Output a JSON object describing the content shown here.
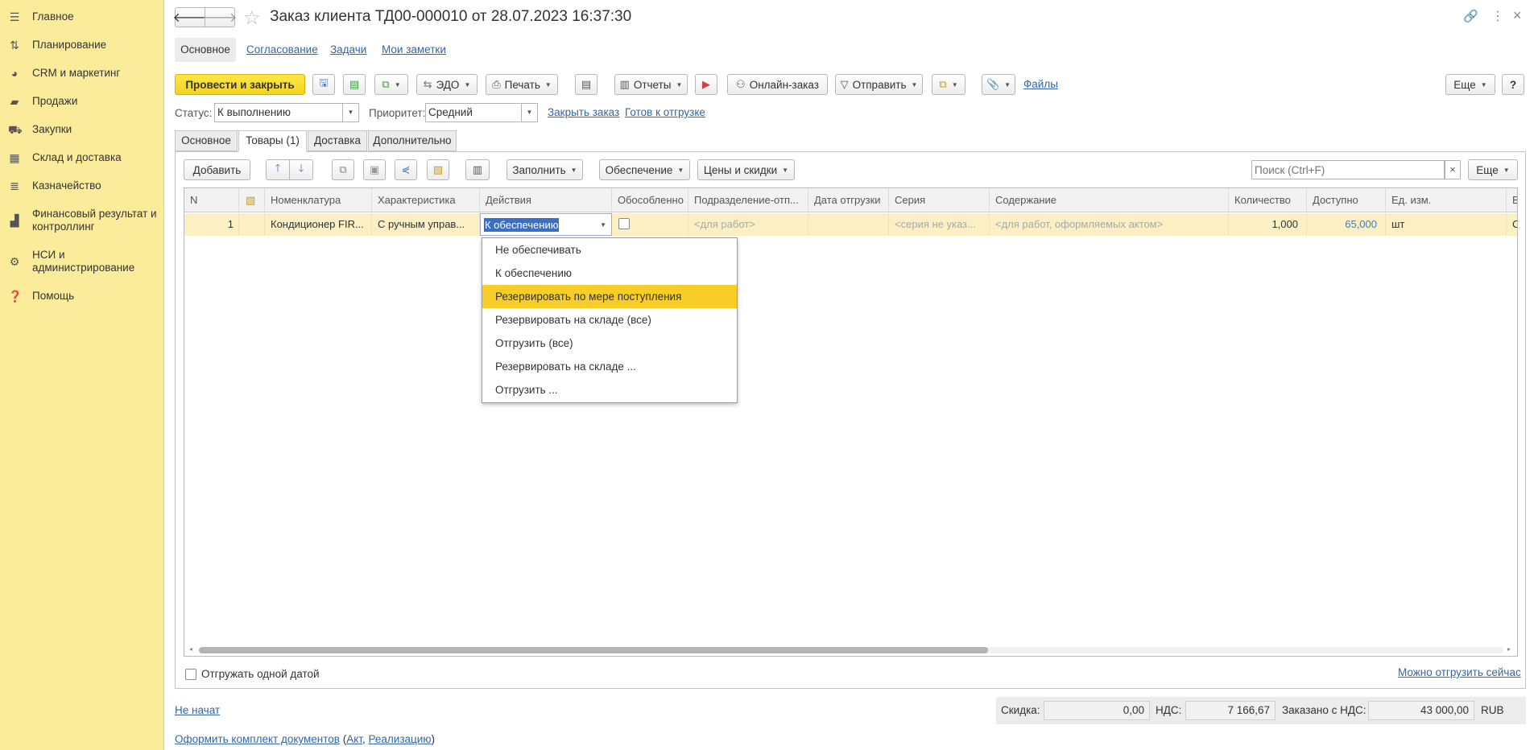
{
  "sidebar": {
    "items": [
      {
        "label": "Главное",
        "icon": "menu-icon"
      },
      {
        "label": "Планирование",
        "icon": "planning-icon"
      },
      {
        "label": "CRM и маркетинг",
        "icon": "pie-chart-icon"
      },
      {
        "label": "Продажи",
        "icon": "bag-icon"
      },
      {
        "label": "Закупки",
        "icon": "cart-icon"
      },
      {
        "label": "Склад и доставка",
        "icon": "grid-icon"
      },
      {
        "label": "Казначейство",
        "icon": "treasury-icon"
      },
      {
        "label": "Финансовый результат и контроллинг",
        "icon": "bar-chart-icon"
      },
      {
        "label": "НСИ и администрирование",
        "icon": "gear-icon"
      },
      {
        "label": "Помощь",
        "icon": "help-icon"
      }
    ]
  },
  "header": {
    "title": "Заказ клиента ТД00-000010 от 28.07.2023 16:37:30"
  },
  "nav_tabs": [
    "Основное",
    "Согласование",
    "Задачи",
    "Мои заметки"
  ],
  "toolbar": {
    "post_close": "Провести и закрыть",
    "edo": "ЭДО",
    "print": "Печать",
    "reports": "Отчеты",
    "online_order": "Онлайн-заказ",
    "send": "Отправить",
    "files": "Файлы",
    "more": "Еще"
  },
  "status_row": {
    "status_label": "Статус:",
    "status_value": "К выполнению",
    "priority_label": "Приоритет:",
    "priority_value": "Средний",
    "close_order": "Закрыть заказ",
    "ready_to_ship": "Готов к отгрузке"
  },
  "form_tabs": [
    "Основное",
    "Товары (1)",
    "Доставка",
    "Дополнительно"
  ],
  "grid_toolbar": {
    "add": "Добавить",
    "fill": "Заполнить",
    "supply": "Обеспечение",
    "prices": "Цены и скидки",
    "search_placeholder": "Поиск (Ctrl+F)",
    "more": "Еще"
  },
  "columns": [
    "N",
    "Номенклатура",
    "Характеристика",
    "Действия",
    "Обособленно",
    "Подразделение-отп...",
    "Дата отгрузки",
    "Серия",
    "Содержание",
    "Количество",
    "Доступно",
    "Ед. изм.",
    "В"
  ],
  "row": {
    "n": "1",
    "nomenclature": "Кондиционер FIR...",
    "characteristic": "С ручным управ...",
    "action": "К обеспечению",
    "division": "<для работ>",
    "series": "<серия не указ...",
    "content": "<для работ, оформляемых актом>",
    "quantity": "1,000",
    "available": "65,000",
    "unit": "шт",
    "extra": "С"
  },
  "dropdown": {
    "options": [
      "Не обеспечивать",
      "К обеспечению",
      "Резервировать по мере поступления",
      "Резервировать на складе (все)",
      "Отгрузить (все)",
      "Резервировать на складе ...",
      "Отгрузить ..."
    ],
    "selected_index": 2
  },
  "bottom": {
    "ship_one_date": "Отгружать одной датой",
    "can_ship_now": "Можно отгрузить сейчас",
    "not_started": "Не начат",
    "discount_label": "Скидка:",
    "discount_value": "0,00",
    "vat_label": "НДС:",
    "vat_value": "7 166,67",
    "ordered_label": "Заказано с НДС:",
    "ordered_value": "43 000,00",
    "currency": "RUB",
    "docs_link": "Оформить комплект документов",
    "docs_open": "(",
    "act": "Акт",
    "comma": ",",
    "realization": "Реализацию",
    "docs_close": ")"
  },
  "colors": {
    "sidebar_bg": "#fbec9c",
    "accent_yellow": "#f9cd27",
    "link_blue": "#3366a8",
    "row_bg": "#fbf0c4"
  }
}
